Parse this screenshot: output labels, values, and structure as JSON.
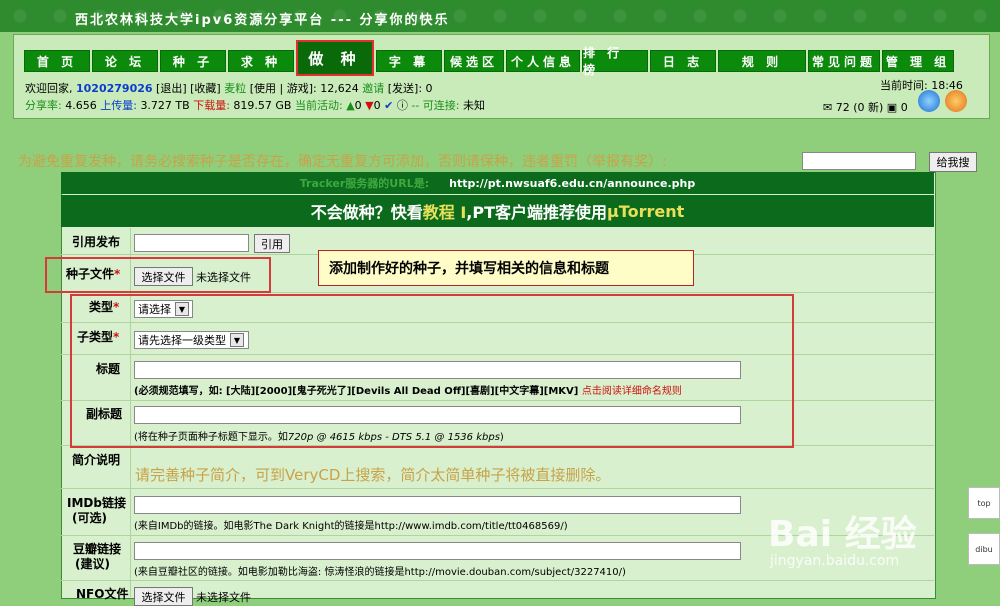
{
  "site": {
    "title": "西北农林科技大学ipv6资源分享平台 --- 分享你的快乐"
  },
  "nav": [
    {
      "label": "首 页",
      "w": 64
    },
    {
      "label": "论 坛",
      "w": 64
    },
    {
      "label": "种 子",
      "w": 64
    },
    {
      "label": "求 种",
      "w": 64
    },
    {
      "label": "做 种",
      "w": 74,
      "active": true
    },
    {
      "label": "字 幕",
      "w": 64
    },
    {
      "label": "候选区",
      "w": 58
    },
    {
      "label": "个人信息",
      "w": 72
    },
    {
      "label": "排 行 榜",
      "w": 64
    },
    {
      "label": "日 志",
      "w": 64
    },
    {
      "label": "规 则",
      "w": 86
    },
    {
      "label": "常见问题",
      "w": 70
    },
    {
      "label": "管 理 组",
      "w": 70
    }
  ],
  "status": {
    "welcome": "欢迎回家,",
    "user": "1020279026",
    "exit": "[退出]",
    "fav": "[收藏]",
    "bonus_label": "麦粒",
    "use": "[使用 | 游戏]:",
    "points": "12,624",
    "invite": "邀请",
    "send": "[发送]:",
    "send_count": "0",
    "ratio_label": "分享率:",
    "ratio": "4.656",
    "upload_label": "上传量:",
    "upload": "3.727 TB",
    "download_label": "下载量:",
    "download": "819.57 GB",
    "activity_label": "当前活动:",
    "seeding": "0",
    "leeching": "0",
    "connectable_label": "-- 可连接:",
    "connectable": "未知",
    "time_label": "当前时间:",
    "time": "18:46",
    "messages": "72 (0 新)",
    "friends": "0"
  },
  "warning": {
    "text": "为避免重复发种，请务必搜索种子是否存在，确定无重复方可添加，否则请保种，违者重罚（举报有奖）:",
    "button": "给我搜"
  },
  "tracker": {
    "label": "Tracker服务器的URL是:",
    "url": "http://pt.nwsuaf6.edu.cn/announce.php"
  },
  "guide": {
    "pre": "不会做种？快看",
    "link": "教程 I",
    "mid": ",PT客户端推荐使用",
    "client": "μTorrent"
  },
  "form": {
    "quote_label": "引用发布",
    "quote_button": "引用",
    "torrent_label": "种子文件",
    "choose_file": "选择文件",
    "no_file": "未选择文件",
    "type_label": "类型",
    "type_value": "请选择",
    "subtype_label": "子类型",
    "subtype_value": "请先选择一级类型",
    "title_label": "标题",
    "title_hint_pre": "(必须规范填写，如: [大陆][2000][鬼子死光了][Devils All Dead Off][喜剧][中文字幕][MKV]",
    "title_hint_link": "点击阅读详细命名规则",
    "subtitle_label": "副标题",
    "subtitle_hint_pre": "(将在种子页面种子标题下显示。如",
    "subtitle_hint_example": "720p @ 4615 kbps - DTS 5.1 @ 1536 kbps",
    "subtitle_hint_post": ")",
    "intro_label": "简介说明",
    "intro_text": "请完善种子简介，可到VeryCD上搜索，简介太简单种子将被直接删除。",
    "imdb_label1": "IMDb链接",
    "imdb_label2": "(可选)",
    "imdb_hint": "(来自IMDb的链接。如电影The Dark Knight的链接是http://www.imdb.com/title/tt0468569/)",
    "douban_label1": "豆瓣链接",
    "douban_label2": "(建议)",
    "douban_hint": "(来自豆瓣社区的链接。如电影加勒比海盗: 惊涛怪浪的链接是http://movie.douban.com/subject/3227410/)",
    "nfo_label": "NFO文件",
    "nfo_choose": "选择文件",
    "nfo_none": "未选择文件"
  },
  "tooltip": "添加制作好的种子，并填写相关的信息和标题",
  "scroll": {
    "top": "top",
    "bottom": "dibu"
  },
  "watermark": {
    "brand": "Bai 经验",
    "url": "jingyan.baidu.com"
  }
}
